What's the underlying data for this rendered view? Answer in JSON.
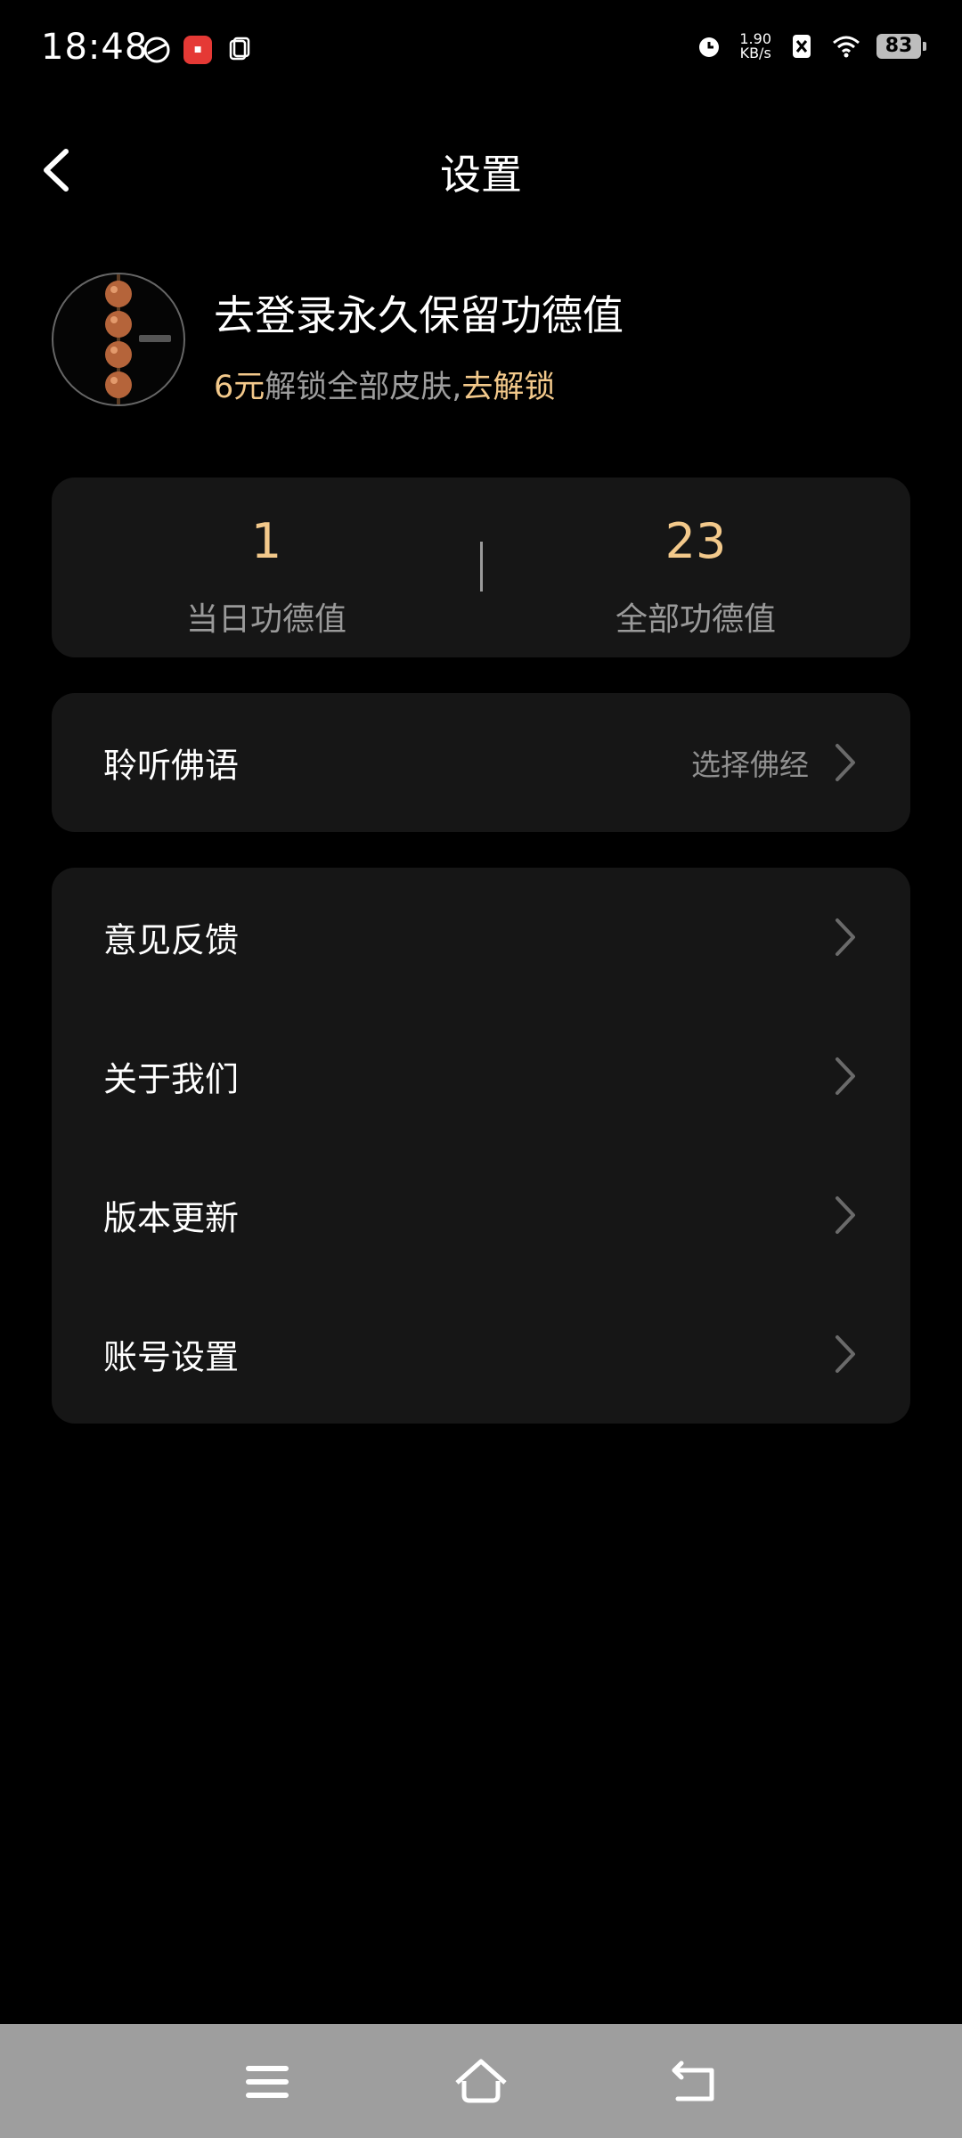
{
  "status_bar": {
    "time": "18:48",
    "net_speed_value": "1.90",
    "net_speed_unit": "KB/s",
    "battery": "83",
    "icons": [
      "app-icon",
      "shop-icon",
      "document-icon",
      "alarm-icon",
      "sim-off-icon",
      "wifi-icon",
      "battery-icon"
    ]
  },
  "header": {
    "title": "设置"
  },
  "profile": {
    "title": "去登录永久保留功德值",
    "price": "6元",
    "unlock_text": "解锁全部皮肤,",
    "unlock_link": "去解锁"
  },
  "stats": {
    "today_value": "1",
    "today_label": "当日功德值",
    "total_value": "23",
    "total_label": "全部功德值"
  },
  "listen": {
    "label": "聆听佛语",
    "value": "选择佛经"
  },
  "menu": {
    "items": [
      {
        "label": "意见反馈"
      },
      {
        "label": "关于我们"
      },
      {
        "label": "版本更新"
      },
      {
        "label": "账号设置"
      }
    ]
  },
  "colors": {
    "accent": "#f3c98b",
    "card": "#161616",
    "background": "#000000"
  }
}
